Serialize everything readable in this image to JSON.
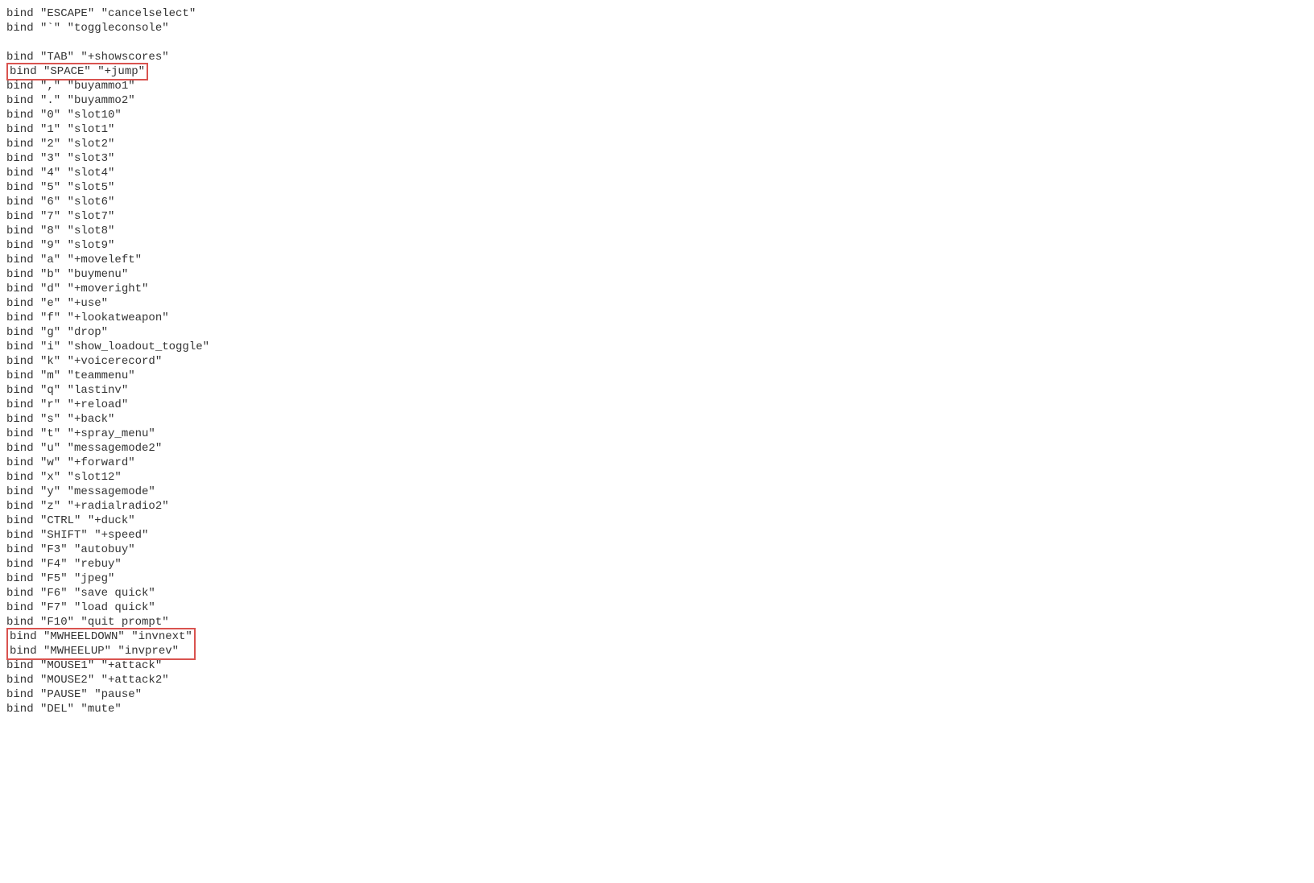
{
  "lines": [
    {
      "text": "bind \"ESCAPE\" \"cancelselect\"",
      "boxed": false
    },
    {
      "text": "bind \"`\" \"toggleconsole\"",
      "boxed": false
    },
    {
      "text": "",
      "boxed": false
    },
    {
      "text": "bind \"TAB\" \"+showscores\"",
      "boxed": false
    },
    {
      "text": "bind \"SPACE\" \"+jump\"",
      "boxed": true
    },
    {
      "text": "bind \",\" \"buyammo1\"",
      "boxed": false
    },
    {
      "text": "bind \".\" \"buyammo2\"",
      "boxed": false
    },
    {
      "text": "bind \"0\" \"slot10\"",
      "boxed": false
    },
    {
      "text": "bind \"1\" \"slot1\"",
      "boxed": false
    },
    {
      "text": "bind \"2\" \"slot2\"",
      "boxed": false
    },
    {
      "text": "bind \"3\" \"slot3\"",
      "boxed": false
    },
    {
      "text": "bind \"4\" \"slot4\"",
      "boxed": false
    },
    {
      "text": "bind \"5\" \"slot5\"",
      "boxed": false
    },
    {
      "text": "bind \"6\" \"slot6\"",
      "boxed": false
    },
    {
      "text": "bind \"7\" \"slot7\"",
      "boxed": false
    },
    {
      "text": "bind \"8\" \"slot8\"",
      "boxed": false
    },
    {
      "text": "bind \"9\" \"slot9\"",
      "boxed": false
    },
    {
      "text": "bind \"a\" \"+moveleft\"",
      "boxed": false
    },
    {
      "text": "bind \"b\" \"buymenu\"",
      "boxed": false
    },
    {
      "text": "bind \"d\" \"+moveright\"",
      "boxed": false
    },
    {
      "text": "bind \"e\" \"+use\"",
      "boxed": false
    },
    {
      "text": "bind \"f\" \"+lookatweapon\"",
      "boxed": false
    },
    {
      "text": "bind \"g\" \"drop\"",
      "boxed": false
    },
    {
      "text": "bind \"i\" \"show_loadout_toggle\"",
      "boxed": false
    },
    {
      "text": "bind \"k\" \"+voicerecord\"",
      "boxed": false
    },
    {
      "text": "bind \"m\" \"teammenu\"",
      "boxed": false
    },
    {
      "text": "bind \"q\" \"lastinv\"",
      "boxed": false
    },
    {
      "text": "bind \"r\" \"+reload\"",
      "boxed": false
    },
    {
      "text": "bind \"s\" \"+back\"",
      "boxed": false
    },
    {
      "text": "bind \"t\" \"+spray_menu\"",
      "boxed": false
    },
    {
      "text": "bind \"u\" \"messagemode2\"",
      "boxed": false
    },
    {
      "text": "bind \"w\" \"+forward\"",
      "boxed": false
    },
    {
      "text": "bind \"x\" \"slot12\"",
      "boxed": false
    },
    {
      "text": "bind \"y\" \"messagemode\"",
      "boxed": false
    },
    {
      "text": "bind \"z\" \"+radialradio2\"",
      "boxed": false
    },
    {
      "text": "bind \"CTRL\" \"+duck\"",
      "boxed": false
    },
    {
      "text": "bind \"SHIFT\" \"+speed\"",
      "boxed": false
    },
    {
      "text": "bind \"F3\" \"autobuy\"",
      "boxed": false
    },
    {
      "text": "bind \"F4\" \"rebuy\"",
      "boxed": false
    },
    {
      "text": "bind \"F5\" \"jpeg\"",
      "boxed": false
    },
    {
      "text": "bind \"F6\" \"save quick\"",
      "boxed": false
    },
    {
      "text": "bind \"F7\" \"load quick\"",
      "boxed": false
    },
    {
      "text": "bind \"F10\" \"quit prompt\"",
      "boxed": false
    },
    {
      "text": "bind \"MWHEELDOWN\" \"invnext\"",
      "boxed": "group-start"
    },
    {
      "text": "bind \"MWHEELUP\" \"invprev\"",
      "boxed": "group-end"
    },
    {
      "text": "bind \"MOUSE1\" \"+attack\"",
      "boxed": false
    },
    {
      "text": "bind \"MOUSE2\" \"+attack2\"",
      "boxed": false
    },
    {
      "text": "bind \"PAUSE\" \"pause\"",
      "boxed": false
    },
    {
      "text": "bind \"DEL\" \"mute\"",
      "boxed": false
    }
  ]
}
